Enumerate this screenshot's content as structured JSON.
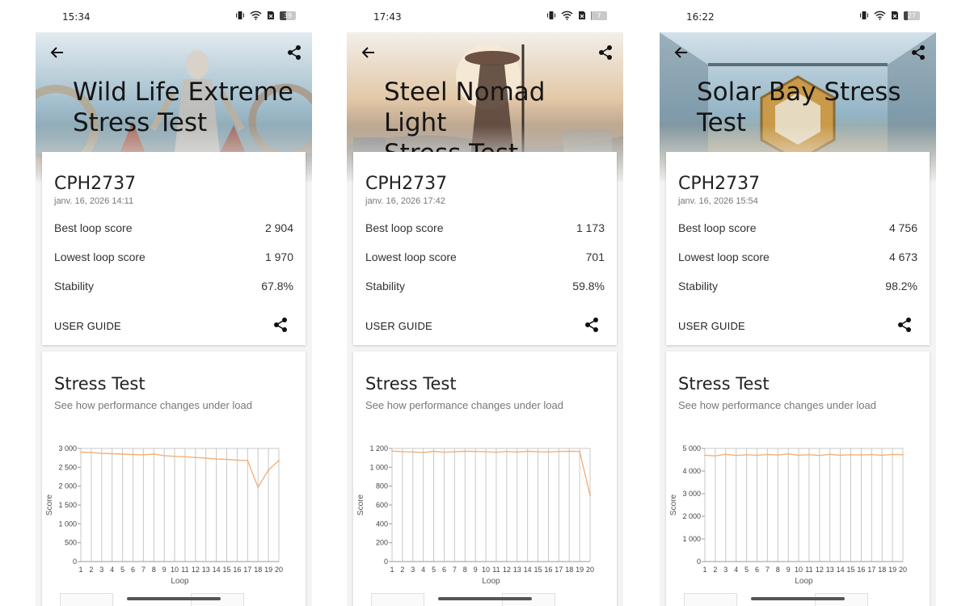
{
  "shared": {
    "chart_title": "Stress Test",
    "chart_subtitle": "See how performance changes under load",
    "best_label": "Best loop score",
    "lowest_label": "Lowest loop score",
    "stability_label": "Stability",
    "user_guide_label": "USER GUIDE",
    "device": "CPH2737",
    "icons": [
      "back-arrow-icon",
      "share-icon",
      "vibrate-icon",
      "wifi-icon",
      "sim-icon",
      "battery-icon"
    ],
    "accent_color": "#f3b07a"
  },
  "screens": [
    {
      "status": {
        "time": "15:34",
        "battery": "39",
        "battery_level": 0.39
      },
      "title_line1": "Wild Life Extreme",
      "title_line2": "Stress Test",
      "date": "janv. 16, 2026 14:11",
      "best_score": "2 904",
      "lowest_score": "1 970",
      "stability": "67.8%"
    },
    {
      "status": {
        "time": "17:43",
        "battery": "7",
        "battery_level": 0.07
      },
      "title_line1": "Steel Nomad Light",
      "title_line2": "Stress Test",
      "date": "janv. 16, 2026 17:42",
      "best_score": "1 173",
      "lowest_score": "701",
      "stability": "59.8%"
    },
    {
      "status": {
        "time": "16:22",
        "battery": "27",
        "battery_level": 0.27
      },
      "title_line1": "Solar Bay Stress",
      "title_line2": "Test",
      "date": "janv. 16, 2026 15:54",
      "best_score": "4 756",
      "lowest_score": "4 673",
      "stability": "98.2%"
    }
  ],
  "chart_data": [
    {
      "type": "line",
      "xlabel": "Loop",
      "ylabel": "Score",
      "x": [
        1,
        2,
        3,
        4,
        5,
        6,
        7,
        8,
        9,
        10,
        11,
        12,
        13,
        14,
        15,
        16,
        17,
        18,
        19,
        20
      ],
      "ylim": [
        0,
        3000
      ],
      "yticks": [
        0,
        500,
        1000,
        1500,
        2000,
        2500,
        3000
      ],
      "ytick_labels": [
        "0",
        "500",
        "1 000",
        "1 500",
        "2 000",
        "2 500",
        "3 000"
      ],
      "series": [
        {
          "values": [
            2904,
            2890,
            2870,
            2860,
            2850,
            2840,
            2830,
            2850,
            2810,
            2790,
            2780,
            2760,
            2740,
            2720,
            2710,
            2690,
            2680,
            1970,
            2430,
            2680
          ]
        }
      ]
    },
    {
      "type": "line",
      "xlabel": "Loop",
      "ylabel": "Score",
      "x": [
        1,
        2,
        3,
        4,
        5,
        6,
        7,
        8,
        9,
        10,
        11,
        12,
        13,
        14,
        15,
        16,
        17,
        18,
        19,
        20
      ],
      "ylim": [
        0,
        1200
      ],
      "yticks": [
        0,
        200,
        400,
        600,
        800,
        1000,
        1200
      ],
      "ytick_labels": [
        "0",
        "200",
        "400",
        "600",
        "800",
        "1 000",
        "1 200"
      ],
      "series": [
        {
          "values": [
            1173,
            1165,
            1162,
            1158,
            1170,
            1160,
            1165,
            1170,
            1168,
            1165,
            1160,
            1168,
            1162,
            1170,
            1165,
            1163,
            1168,
            1170,
            1168,
            701
          ]
        }
      ]
    },
    {
      "type": "line",
      "xlabel": "Loop",
      "ylabel": "Score",
      "x": [
        1,
        2,
        3,
        4,
        5,
        6,
        7,
        8,
        9,
        10,
        11,
        12,
        13,
        14,
        15,
        16,
        17,
        18,
        19,
        20
      ],
      "ylim": [
        0,
        5000
      ],
      "yticks": [
        0,
        1000,
        2000,
        3000,
        4000,
        5000
      ],
      "ytick_labels": [
        "0",
        "1 000",
        "2 000",
        "3 000",
        "4 000",
        "5 000"
      ],
      "series": [
        {
          "values": [
            4700,
            4673,
            4740,
            4690,
            4720,
            4700,
            4730,
            4710,
            4756,
            4700,
            4720,
            4690,
            4740,
            4700,
            4720,
            4710,
            4730,
            4700,
            4740,
            4720
          ]
        }
      ]
    }
  ]
}
